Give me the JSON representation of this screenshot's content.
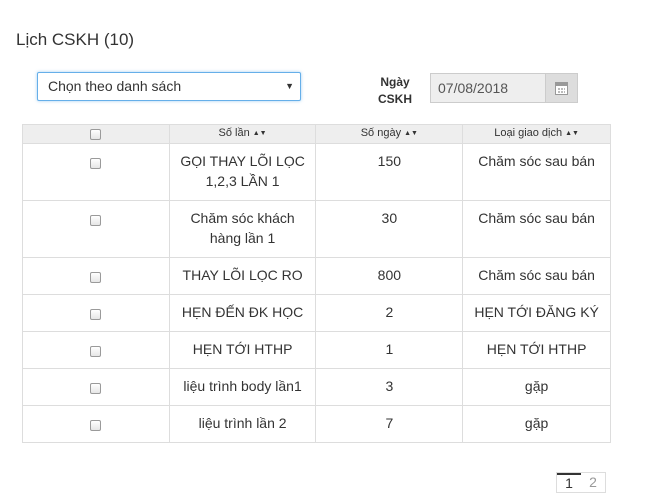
{
  "header": {
    "title": "Lịch CSKH (10)"
  },
  "filter": {
    "select_value": "Chọn theo danh sách",
    "date_label": "Ngày CSKH",
    "date_value": "07/08/2018",
    "date_icon": "calendar-icon"
  },
  "table": {
    "columns": [
      "Số lần",
      "Số ngày",
      "Loại giao dịch"
    ],
    "sort_icon": "sort-icon",
    "rows": [
      {
        "name": "GỌI THAY LÕI LỌC 1,2,3 LẦN 1",
        "days": "150",
        "type": "Chăm sóc sau bán"
      },
      {
        "name": "Chăm sóc khách hàng lần 1",
        "days": "30",
        "type": "Chăm sóc sau bán"
      },
      {
        "name": "THAY LÕI LỌC RO",
        "days": "800",
        "type": "Chăm sóc sau bán"
      },
      {
        "name": "HẸN ĐẾN ĐK HỌC",
        "days": "2",
        "type": "HẸN TỚI ĐĂNG KÝ"
      },
      {
        "name": "HẸN TỚI HTHP",
        "days": "1",
        "type": "HẸN TỚI HTHP"
      },
      {
        "name": "liệu trình body lần1",
        "days": "3",
        "type": "gặp"
      },
      {
        "name": "liệu trình lần 2",
        "days": "7",
        "type": "gặp"
      }
    ]
  },
  "pagination": {
    "pages": [
      "1",
      "2"
    ],
    "active": "1"
  }
}
